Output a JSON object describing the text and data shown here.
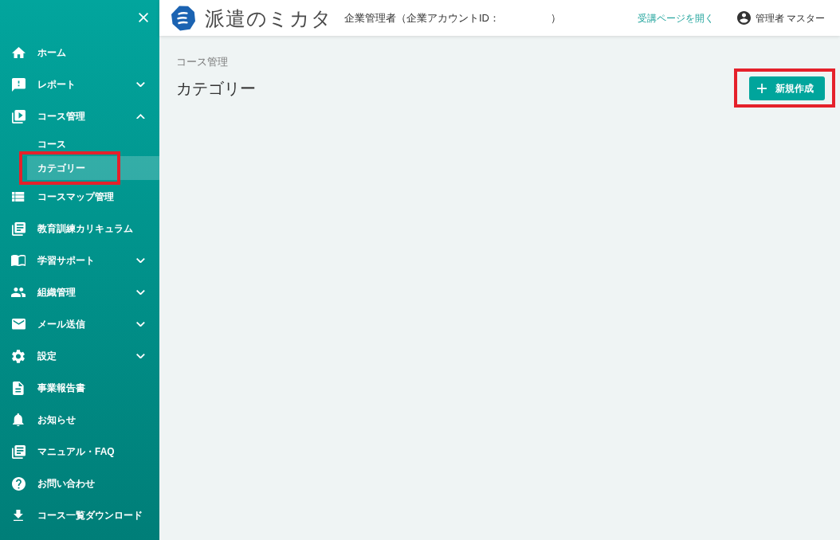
{
  "sidebar": {
    "items": [
      {
        "label": "ホーム",
        "selected": false
      },
      {
        "label": "レポート",
        "selected": false,
        "expanded": false
      },
      {
        "label": "コース管理",
        "selected": false,
        "expanded": true,
        "children": [
          {
            "label": "コース",
            "selected": false,
            "highlighted": false
          },
          {
            "label": "カテゴリー",
            "selected": true,
            "highlighted": true
          }
        ]
      },
      {
        "label": "コースマップ管理",
        "selected": false
      },
      {
        "label": "教育訓練カリキュラム",
        "selected": false
      },
      {
        "label": "学習サポート",
        "selected": false,
        "expanded": false
      },
      {
        "label": "組織管理",
        "selected": false,
        "expanded": false
      },
      {
        "label": "メール送信",
        "selected": false,
        "expanded": false
      },
      {
        "label": "設定",
        "selected": false,
        "expanded": false
      },
      {
        "label": "事業報告書",
        "selected": false
      },
      {
        "label": "お知らせ",
        "selected": false
      },
      {
        "label": "マニュアル・FAQ",
        "selected": false
      },
      {
        "label": "お問い合わせ",
        "selected": false
      },
      {
        "label": "コース一覧ダウンロード",
        "selected": false
      }
    ]
  },
  "header": {
    "logo_text": "派遣のミカタ",
    "account_label": "企業管理者（企業アカウントID：",
    "account_label_end": "）",
    "learner_page_link": "受講ページを開く",
    "user_name": "管理者 マスター"
  },
  "main": {
    "breadcrumb": "コース管理",
    "title": "カテゴリー",
    "new_button": {
      "label": "新規作成",
      "highlighted": true
    }
  }
}
